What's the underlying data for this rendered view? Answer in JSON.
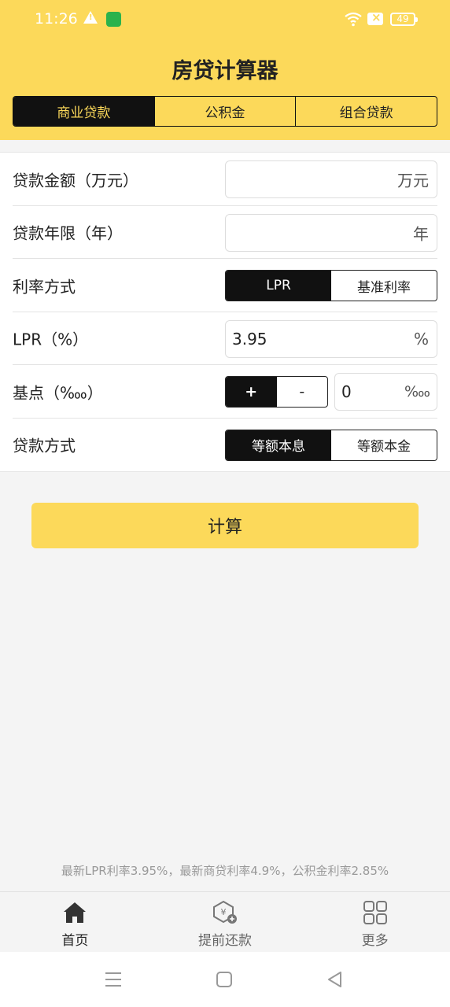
{
  "status": {
    "time": "11:26",
    "battery": "49"
  },
  "header": {
    "title": "房贷计算器",
    "tabs": [
      {
        "label": "商业贷款",
        "active": true
      },
      {
        "label": "公积金",
        "active": false
      },
      {
        "label": "组合贷款",
        "active": false
      }
    ]
  },
  "form": {
    "amount": {
      "label": "贷款金额（万元）",
      "value": "",
      "placeholder": "",
      "unit": "万元"
    },
    "years": {
      "label": "贷款年限（年）",
      "value": "",
      "placeholder": "",
      "unit": "年"
    },
    "rate_mode": {
      "label": "利率方式",
      "options": [
        "LPR",
        "基准利率"
      ],
      "selected": "LPR"
    },
    "lpr": {
      "label": "LPR（%）",
      "value": "3.95",
      "unit": "%"
    },
    "basis": {
      "label": "基点（‱）",
      "plus": "+",
      "minus": "-",
      "selected": "+",
      "value": "0",
      "unit": "‱"
    },
    "repay": {
      "label": "贷款方式",
      "options": [
        "等额本息",
        "等额本金"
      ],
      "selected": "等额本息"
    }
  },
  "calc_button": "计算",
  "footnote": "最新LPR利率3.95%，最新商贷利率4.9%，公积金利率2.85%",
  "tabbar": [
    {
      "label": "首页",
      "icon": "home-icon",
      "active": true
    },
    {
      "label": "提前还款",
      "icon": "prepay-icon",
      "active": false
    },
    {
      "label": "更多",
      "icon": "grid-icon",
      "active": false
    }
  ],
  "colors": {
    "accent": "#fcd95a",
    "dark": "#111111",
    "background": "#f4f4f4"
  }
}
